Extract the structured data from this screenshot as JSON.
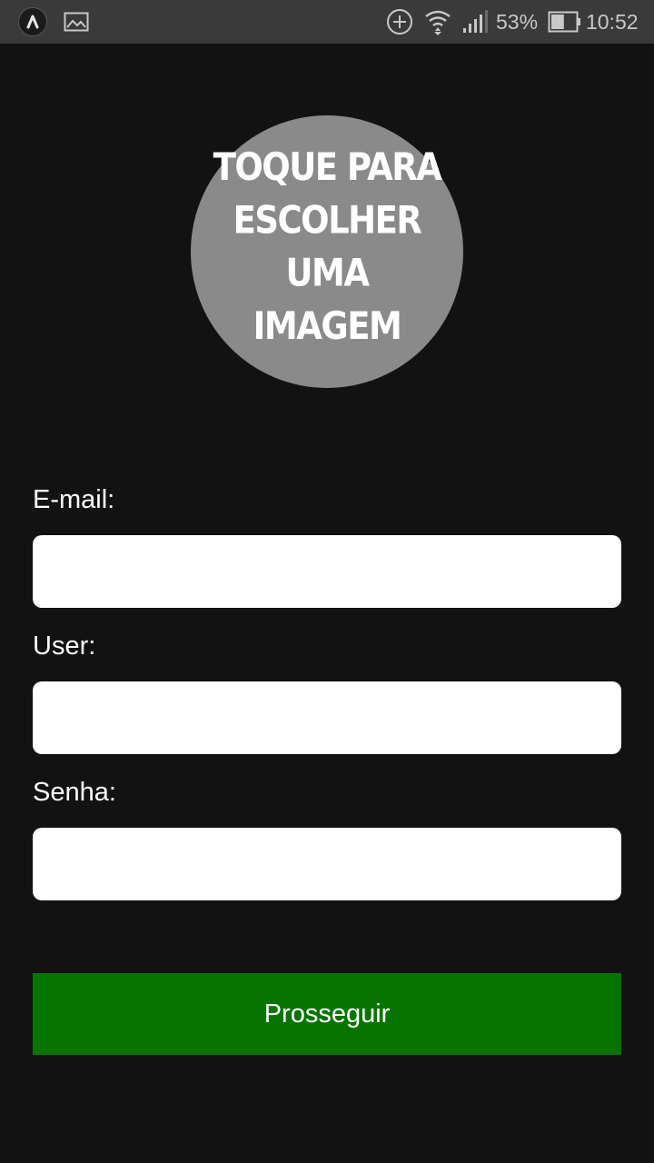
{
  "status_bar": {
    "battery_percent": "53%",
    "battery_level": 0.53,
    "time": "10:52",
    "icons": [
      "app-launcher-icon",
      "gallery-icon",
      "add-circle-icon",
      "wifi-icon",
      "cell-signal-icon",
      "battery-icon"
    ]
  },
  "avatar": {
    "text": "TOQUE PARA ESCOLHER UMA IMAGEM",
    "color": "#8a8a8a"
  },
  "form": {
    "email_label": "E-mail:",
    "email_value": "",
    "user_label": "User:",
    "user_value": "",
    "password_label": "Senha:",
    "password_value": ""
  },
  "button": {
    "label": "Prosseguir",
    "color": "#077400"
  },
  "colors": {
    "background": "#121212",
    "status_bar": "#3a3a3a"
  }
}
